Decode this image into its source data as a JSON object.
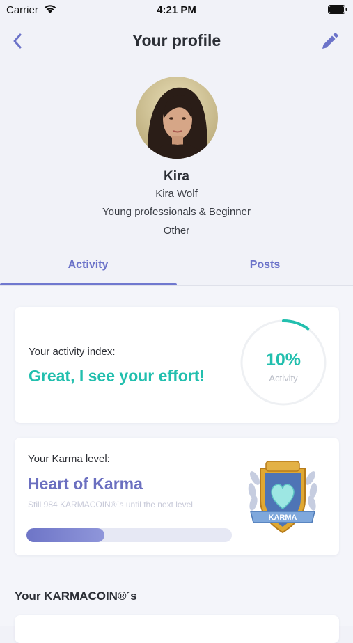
{
  "status_bar": {
    "carrier": "Carrier",
    "time": "4:21 PM"
  },
  "nav": {
    "title": "Your profile",
    "back_icon": "chevron-left-icon",
    "edit_icon": "pencil-icon"
  },
  "profile": {
    "name": "Kira",
    "full_name": "Kira Wolf",
    "group": "Young professionals & Beginner",
    "other": "Other"
  },
  "tabs": [
    {
      "label": "Activity",
      "selected": true
    },
    {
      "label": "Posts",
      "selected": false
    }
  ],
  "activity": {
    "label": "Your activity index:",
    "message": "Great, I see your effort!",
    "percent_text": "10%",
    "percent": 10,
    "caption": "Activity"
  },
  "karma": {
    "label": "Your Karma level:",
    "level": "Heart of Karma",
    "remaining": "Still 984 KARMACOIN®´s until the next level",
    "progress": 0.38,
    "badge_text": "KARMA"
  },
  "coins": {
    "heading": "Your KARMACOIN®´s"
  },
  "colors": {
    "accent_purple": "#6c73c9",
    "accent_teal": "#22bfae",
    "background": "#f1f2f8"
  }
}
